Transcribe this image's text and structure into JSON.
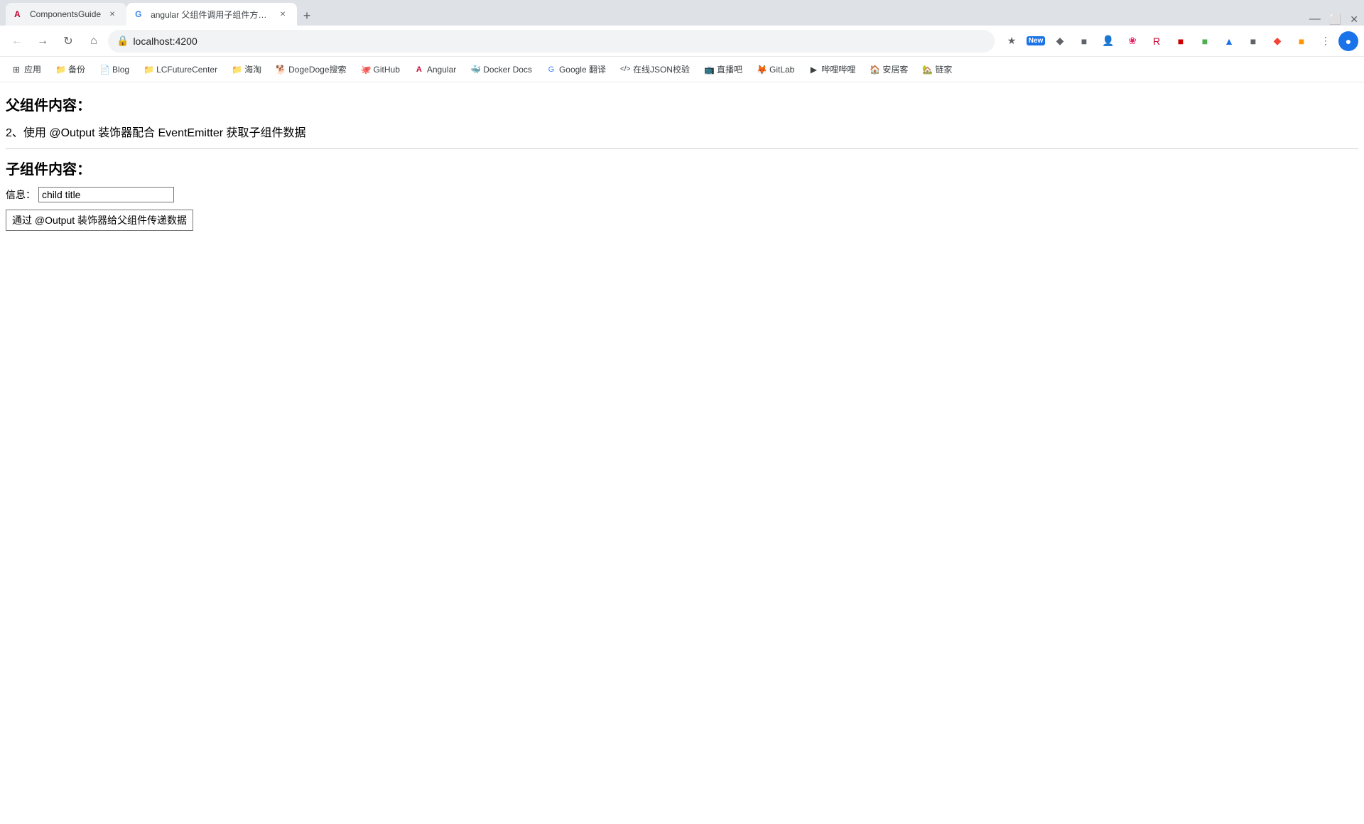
{
  "browser": {
    "tabs": [
      {
        "id": "tab1",
        "favicon": "A",
        "favicon_color": "#c3002f",
        "title": "ComponentsGuide",
        "active": false
      },
      {
        "id": "tab2",
        "favicon": "G",
        "favicon_color": "#4285f4",
        "title": "angular 父组件调用子组件方法：",
        "active": true
      }
    ],
    "address": "localhost:4200",
    "lock_icon": "🔒",
    "window_title": "angular 父组件调用子组件方法：",
    "nav": {
      "back": "←",
      "forward": "→",
      "reload": "↻",
      "home": "⌂"
    }
  },
  "bookmarks": [
    {
      "id": "apps",
      "icon": "⊞",
      "label": "应用"
    },
    {
      "id": "backup",
      "icon": "📁",
      "label": "备份"
    },
    {
      "id": "blog",
      "icon": "📄",
      "label": "Blog"
    },
    {
      "id": "lcfuture",
      "icon": "📁",
      "label": "LCFutureCenter"
    },
    {
      "id": "hainan",
      "icon": "📁",
      "label": "海淘"
    },
    {
      "id": "dogedoge",
      "icon": "🐕",
      "label": "DogeDoge搜索"
    },
    {
      "id": "github",
      "icon": "🐙",
      "label": "GitHub"
    },
    {
      "id": "angular",
      "icon": "A",
      "label": "Angular"
    },
    {
      "id": "docker",
      "icon": "🐳",
      "label": "Docker Docs"
    },
    {
      "id": "google-translate",
      "icon": "G",
      "label": "Google 翻译"
    },
    {
      "id": "json",
      "icon": "</>",
      "label": "在线JSON校验"
    },
    {
      "id": "zhibo",
      "icon": "📺",
      "label": "直播吧"
    },
    {
      "id": "gitlab",
      "icon": "🦊",
      "label": "GitLab"
    },
    {
      "id": "bibi",
      "icon": "▶",
      "label": "哔哩哔哩"
    },
    {
      "id": "anjuke",
      "icon": "🏠",
      "label": "安居客"
    },
    {
      "id": "lianjia",
      "icon": "🏡",
      "label": "链家"
    }
  ],
  "page": {
    "parent_heading": "父组件内容：",
    "instruction": "2、使用 @Output 装饰器配合 EventEmitter 获取子组件数据",
    "child_heading": "子组件内容：",
    "info_label": "信息：",
    "info_input_value": "child title",
    "send_button_label": "通过 @Output 装饰器给父组件传递数据"
  }
}
